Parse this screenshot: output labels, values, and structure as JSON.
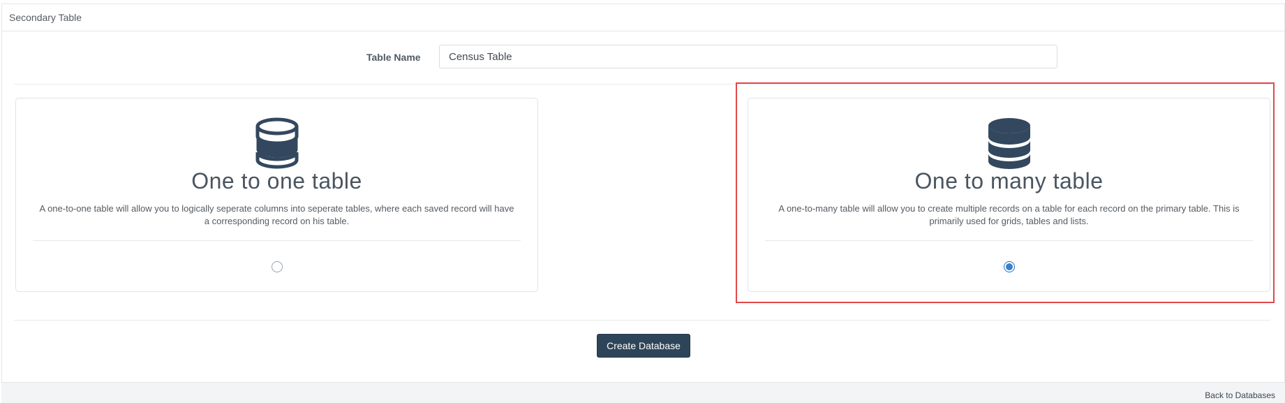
{
  "panel": {
    "title": "Secondary Table"
  },
  "form": {
    "table_name_label": "Table Name",
    "table_name_value": "Census Table"
  },
  "options": [
    {
      "title": "One to one table",
      "description": "A one-to-one table will allow you to logically seperate columns into seperate tables, where each saved record will have a corresponding record on his table.",
      "selected": false,
      "icon": "database-icon"
    },
    {
      "title": "One to many table",
      "description": "A one-to-many table will allow you to create multiple records on a table for each record on the primary table. This is primarily used for grids, tables and lists.",
      "selected": true,
      "icon": "database-icon"
    }
  ],
  "actions": {
    "create_label": "Create Database"
  },
  "footer": {
    "back_label": "Back to Databases"
  },
  "colors": {
    "primary_button": "#2e4459",
    "radio_selected": "#3a7fcf",
    "highlight": "#e04848",
    "icon": "#33485e"
  }
}
